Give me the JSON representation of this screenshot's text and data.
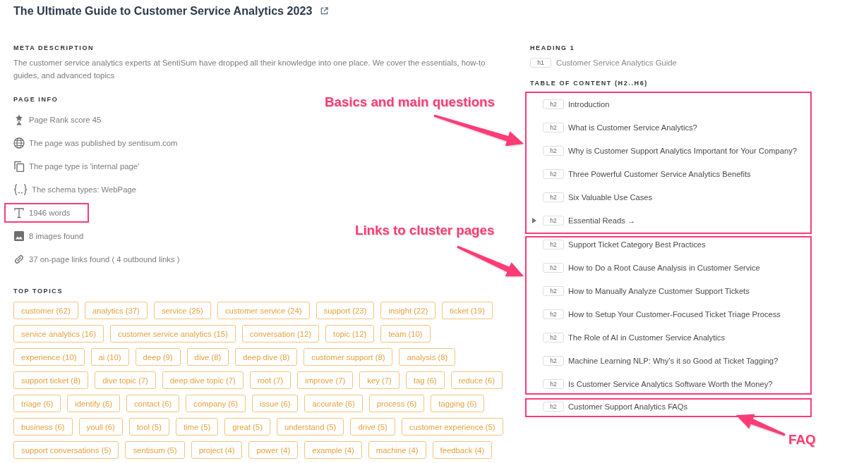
{
  "title": {
    "text": "The Ultimate Guide to Customer Service Analytics 2023"
  },
  "meta_description": {
    "label": "META DESCRIPTION",
    "text": "The customer service analytics experts at SentiSum have dropped all their knowledge into one place. We cover the essentials, how-to guides, and advanced topics"
  },
  "page_info": {
    "label": "PAGE INFO",
    "items": [
      {
        "text": "Page Rank score 45",
        "highlighted": false
      },
      {
        "text": "The page was published by sentisum.com",
        "highlighted": false
      },
      {
        "text": "The page type is 'internal page'",
        "highlighted": false
      },
      {
        "text": "The schema types: WebPage",
        "highlighted": false
      },
      {
        "text": "1946 words",
        "highlighted": true
      },
      {
        "text": "8 images found",
        "highlighted": false
      },
      {
        "text": "37 on-page links found ( 4 outbound links )",
        "highlighted": false
      }
    ]
  },
  "top_topics": {
    "label": "TOP TOPICS",
    "tags": [
      "customer (62)",
      "analytics (37)",
      "service (25)",
      "customer service (24)",
      "support (23)",
      "insight (22)",
      "ticket (19)",
      "service analytics (16)",
      "customer service analytics (15)",
      "conversation (12)",
      "topic (12)",
      "team (10)",
      "experience (10)",
      "ai (10)",
      "deep (9)",
      "dive (8)",
      "deep dive (8)",
      "customer support (8)",
      "analysis (8)",
      "support ticket (8)",
      "dive topic (7)",
      "deep dive topic (7)",
      "root (7)",
      "improve (7)",
      "key (7)",
      "tag (6)",
      "reduce (6)",
      "triage (6)",
      "identify (6)",
      "contact (6)",
      "company (6)",
      "issue (6)",
      "accurate (6)",
      "process (6)",
      "tagging (6)",
      "business (6)",
      "youll (6)",
      "tool (5)",
      "time (5)",
      "great (5)",
      "understand (5)",
      "drive (5)",
      "customer experience (5)",
      "support conversations (5)",
      "sentisum (5)",
      "project (4)",
      "power (4)",
      "example (4)",
      "machine (4)",
      "feedback (4)"
    ]
  },
  "heading_1": {
    "label": "HEADING 1",
    "tag": "h1",
    "text": "Customer Service Analytics Guide"
  },
  "table_of_content": {
    "label": "TABLE OF CONTENT (H2..H6)",
    "groups": [
      {
        "callout": "Basics and main questions",
        "items": [
          {
            "tag": "h2",
            "text": "Introduction",
            "expandable": false
          },
          {
            "tag": "h2",
            "text": "What is Customer Service Analytics?",
            "expandable": false
          },
          {
            "tag": "h2",
            "text": "Why is Customer Support Analytics Important for Your Company?",
            "expandable": false
          },
          {
            "tag": "h2",
            "text": "Three Powerful Customer Service Analytics Benefits",
            "expandable": false
          },
          {
            "tag": "h2",
            "text": "Six Valuable Use Cases",
            "expandable": false
          },
          {
            "tag": "h2",
            "text": "Essential Reads →",
            "expandable": true,
            "expanded": false
          }
        ]
      },
      {
        "callout": "Links to cluster pages",
        "items": [
          {
            "tag": "h2",
            "text": "Support Ticket Category Best Practices",
            "expandable": false
          },
          {
            "tag": "h2",
            "text": "How to Do a Root Cause Analysis in Customer Service",
            "expandable": false
          },
          {
            "tag": "h2",
            "text": "How to Manually Analyze Customer Support Tickets",
            "expandable": false
          },
          {
            "tag": "h2",
            "text": "How to Setup Your Customer-Focused Ticket Triage Process",
            "expandable": false
          },
          {
            "tag": "h2",
            "text": "The Role of AI in Customer Service Analytics",
            "expandable": false
          },
          {
            "tag": "h2",
            "text": "Machine Learning NLP: Why's it so Good at Ticket Tagging?",
            "expandable": false
          },
          {
            "tag": "h2",
            "text": "Is Customer Service Analytics Software Worth the Money?",
            "expandable": false
          }
        ]
      },
      {
        "callout": "FAQ",
        "items": [
          {
            "tag": "h2",
            "text": "Customer Support Analytics FAQs",
            "expandable": false
          }
        ]
      }
    ]
  }
}
